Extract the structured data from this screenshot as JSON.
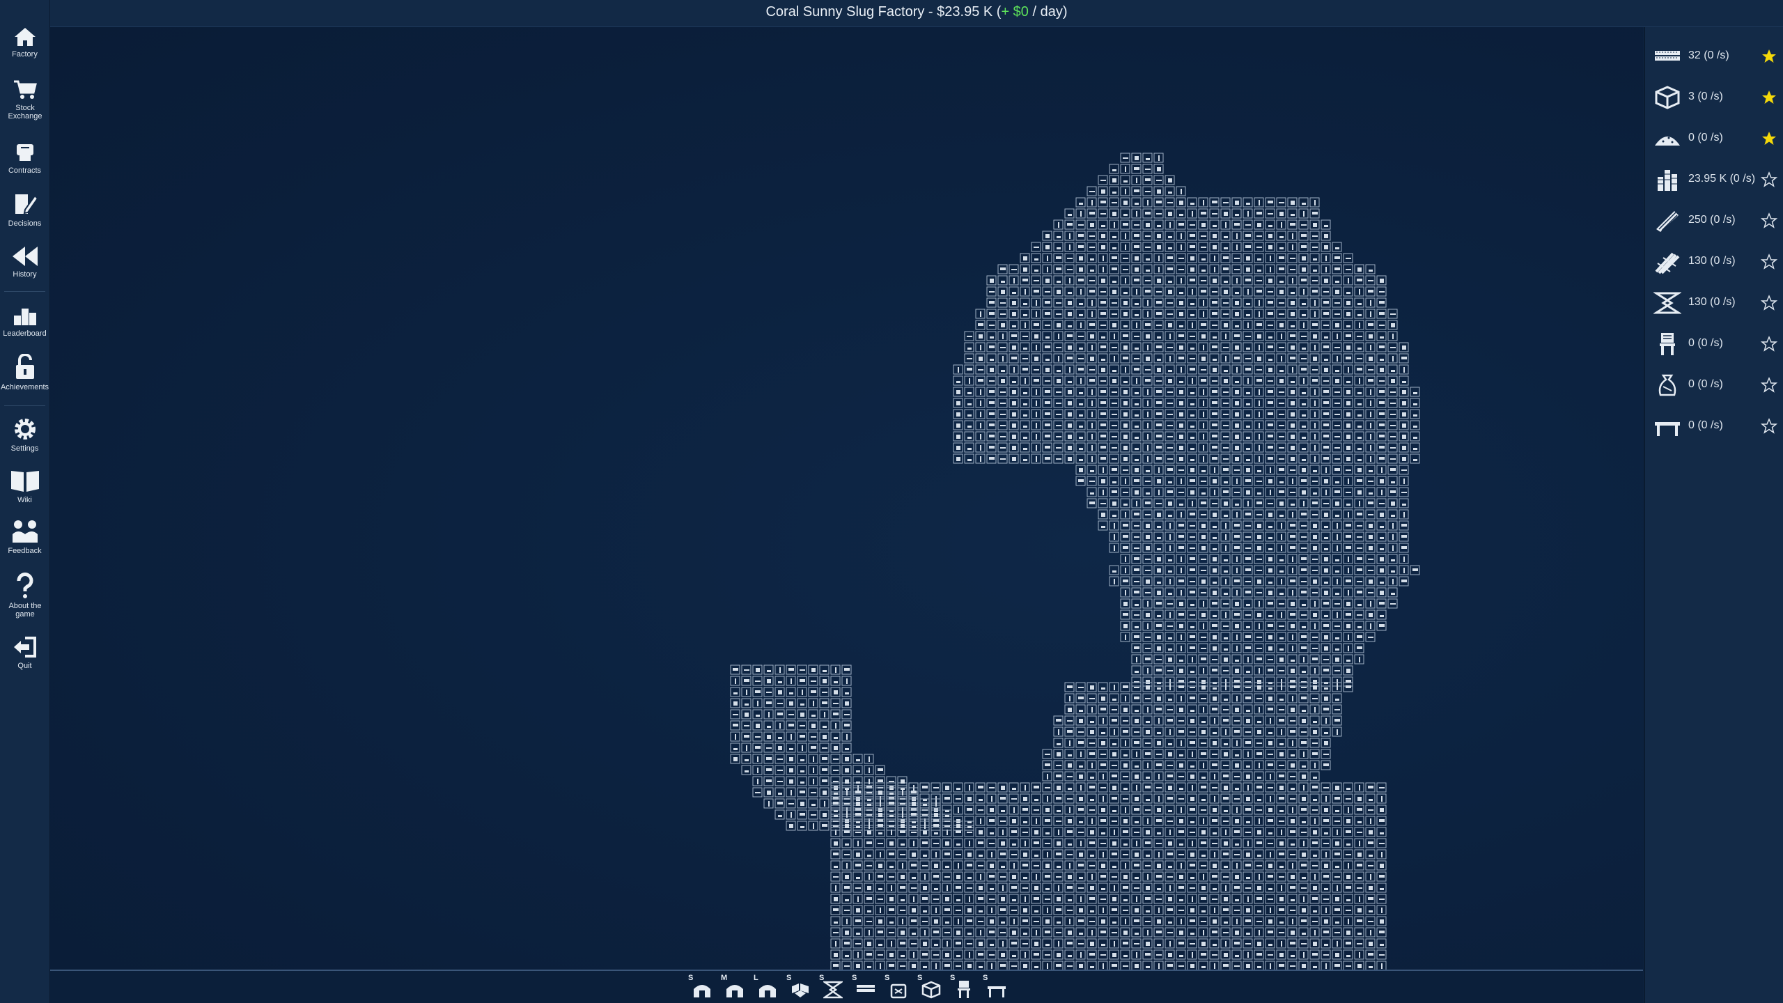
{
  "title": {
    "prefix": "Coral Sunny Slug Factory - $23.95 K (",
    "income": "+ $0",
    "suffix": " / day)"
  },
  "sidebar": {
    "items": [
      {
        "label": "Factory",
        "icon": "home-icon"
      },
      {
        "label": "Stock Exchange",
        "icon": "cart-icon"
      },
      {
        "label": "Contracts",
        "icon": "handshake-icon"
      },
      {
        "label": "Decisions",
        "icon": "pen-paper-icon"
      },
      {
        "label": "History",
        "icon": "rewind-icon"
      },
      {
        "label": "Leaderboard",
        "icon": "podium-icon"
      },
      {
        "label": "Achievements",
        "icon": "unlock-icon"
      },
      {
        "label": "Settings",
        "icon": "gear-icon"
      },
      {
        "label": "Wiki",
        "icon": "book-icon"
      },
      {
        "label": "Feedback",
        "icon": "people-icon"
      },
      {
        "label": "About the game",
        "icon": "question-icon"
      },
      {
        "label": "Quit",
        "icon": "exit-icon"
      }
    ]
  },
  "resources": [
    {
      "amount": "32 (0 /s)",
      "icon": "planks-icon",
      "starred": true
    },
    {
      "amount": "3 (0 /s)",
      "icon": "box-icon",
      "starred": true
    },
    {
      "amount": "0 (0 /s)",
      "icon": "pile-icon",
      "starred": true
    },
    {
      "amount": "23.95 K (0 /s)",
      "icon": "money-icon",
      "starred": false
    },
    {
      "amount": "250 (0 /s)",
      "icon": "logs-icon",
      "starred": false
    },
    {
      "amount": "130 (0 /s)",
      "icon": "bundle-icon",
      "starred": false
    },
    {
      "amount": "130 (0 /s)",
      "icon": "ribbon-icon",
      "starred": false
    },
    {
      "amount": "0 (0 /s)",
      "icon": "chair-icon",
      "starred": false
    },
    {
      "amount": "0 (0 /s)",
      "icon": "bag-icon",
      "starred": false
    },
    {
      "amount": "0 (0 /s)",
      "icon": "table-icon",
      "starred": false
    }
  ],
  "toolbar": [
    {
      "letter": "S",
      "icon": "sawmill-small-icon"
    },
    {
      "letter": "M",
      "icon": "sawmill-medium-icon"
    },
    {
      "letter": "L",
      "icon": "sawmill-large-icon"
    },
    {
      "letter": "S",
      "icon": "boxes-icon"
    },
    {
      "letter": "S",
      "icon": "ribbon-tool-icon"
    },
    {
      "letter": "S",
      "icon": "planks-tool-icon"
    },
    {
      "letter": "S",
      "icon": "sack-tool-icon"
    },
    {
      "letter": "S",
      "icon": "box-tool-icon"
    },
    {
      "letter": "S",
      "icon": "chair-tool-icon"
    },
    {
      "letter": "S",
      "icon": "table-tool-icon"
    }
  ],
  "colors": {
    "background": "#0d2341",
    "panel": "#132a47",
    "income": "#5ee35a",
    "star": "#f5d90a",
    "tile": "#c7d2dd"
  }
}
